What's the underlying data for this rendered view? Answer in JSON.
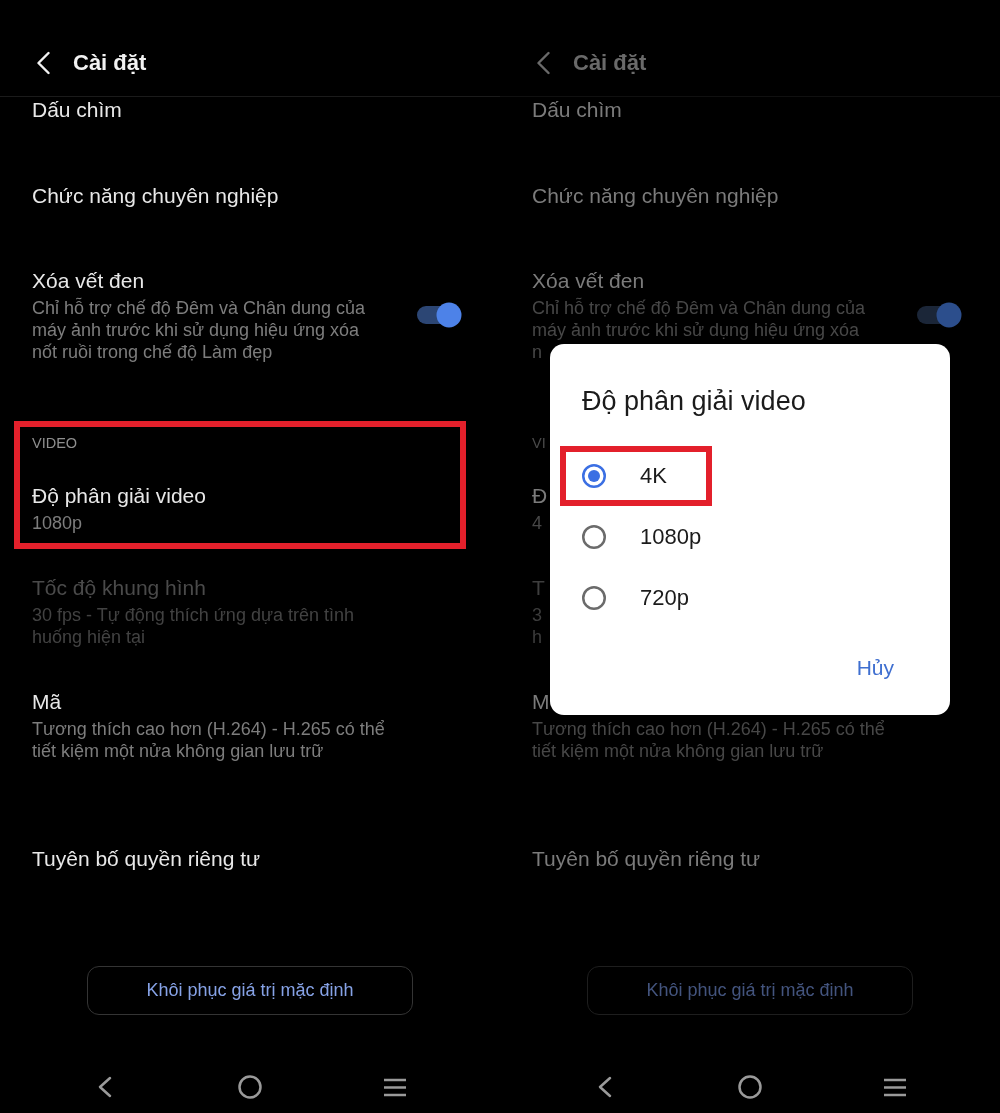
{
  "screens": [
    {
      "dimmed": false,
      "header": {
        "title": "Cài đặt"
      },
      "groups": [
        {
          "highlighted": false,
          "items": [
            {
              "title": "Dấu chìm",
              "disabled": false
            },
            {
              "title": "Chức năng chuyên nghiệp",
              "disabled": false
            },
            {
              "title": "Xóa vết đen",
              "description": "Chỉ hỗ trợ chế độ Đêm và Chân dung của máy ảnh trước khi sử dụng hiệu ứng xóa nốt ruồi trong chế độ Làm đẹp",
              "disabled": false,
              "toggle": {
                "on": true
              }
            }
          ]
        },
        {
          "label": "VIDEO",
          "highlighted": true,
          "items": [
            {
              "title": "Độ phân giải video",
              "description": "1080p",
              "disabled": false
            },
            {
              "title": "Tốc độ khung hình",
              "description": "30 fps - Tự động thích ứng dựa trên tình huống hiện tại",
              "disabled": true
            },
            {
              "title": "Mã",
              "description": "Tương thích cao hơn (H.264) - H.265 có thể tiết kiệm một nửa không gian lưu trữ",
              "disabled": false
            }
          ]
        },
        {
          "highlighted": false,
          "items": [
            {
              "title": "Tuyên bố quyền riêng tư",
              "disabled": false
            }
          ]
        }
      ],
      "reset_button": "Khôi phục giá trị mặc định"
    },
    {
      "dimmed": true,
      "header": {
        "title": "Cài đặt"
      },
      "groups": [
        {
          "highlighted": false,
          "items": [
            {
              "title": "Dấu chìm",
              "disabled": false
            },
            {
              "title": "Chức năng chuyên nghiệp",
              "disabled": false
            },
            {
              "title": "Xóa vết đen",
              "description": "Chỉ hỗ trợ chế độ Đêm và Chân dung của máy ảnh trước khi sử dụng hiệu ứng xóa",
              "description_tail": "n",
              "disabled": false,
              "toggle": {
                "on": true
              }
            }
          ]
        },
        {
          "label": "VI",
          "highlighted": false,
          "items": [
            {
              "title": "Đ",
              "description": "4",
              "disabled": false
            },
            {
              "title": "T",
              "description": "3",
              "description_tail": "h",
              "disabled": true
            },
            {
              "title": "M",
              "description": "Tương thích cao hơn (H.264) - H.265 có thể tiết kiệm một nửa không gian lưu trữ",
              "disabled": false
            }
          ]
        },
        {
          "highlighted": false,
          "items": [
            {
              "title": "Tuyên bố quyền riêng tư",
              "disabled": false
            }
          ]
        }
      ],
      "reset_button": "Khôi phục giá trị mặc định",
      "dialog": {
        "title": "Độ phân giải video",
        "options": [
          {
            "label": "4K",
            "selected": true,
            "highlighted": true
          },
          {
            "label": "1080p",
            "selected": false,
            "highlighted": false
          },
          {
            "label": "720p",
            "selected": false,
            "highlighted": false
          }
        ],
        "cancel_button": "Hủy"
      }
    }
  ]
}
